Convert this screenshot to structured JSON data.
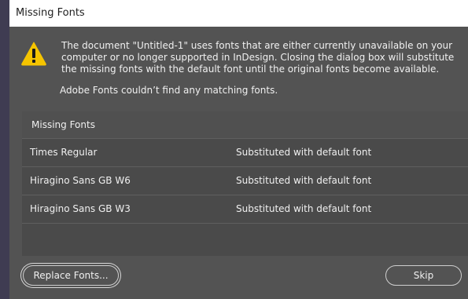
{
  "dialog": {
    "title": "Missing Fonts",
    "message_lines": [
      "The document \"Untitled-1\" uses fonts that are either currently unavailable on your",
      "computer or no longer supported in InDesign. Closing the dialog box will substitute",
      "the missing fonts with the default font until the original fonts become available."
    ],
    "adobe_fonts_note": "Adobe Fonts couldn’t find any matching fonts.",
    "icon": "warning-icon",
    "colors": {
      "background": "#535353",
      "warning": "#f5c400",
      "titlebar": "#ffffff"
    }
  },
  "table": {
    "header": "Missing Fonts",
    "rows": [
      {
        "font": "Times Regular",
        "status": "Substituted with default font"
      },
      {
        "font": "Hiragino Sans GB W6",
        "status": "Substituted with default font"
      },
      {
        "font": "Hiragino Sans GB W3",
        "status": "Substituted with default font"
      }
    ]
  },
  "buttons": {
    "replace_fonts": "Replace Fonts...",
    "skip": "Skip"
  }
}
